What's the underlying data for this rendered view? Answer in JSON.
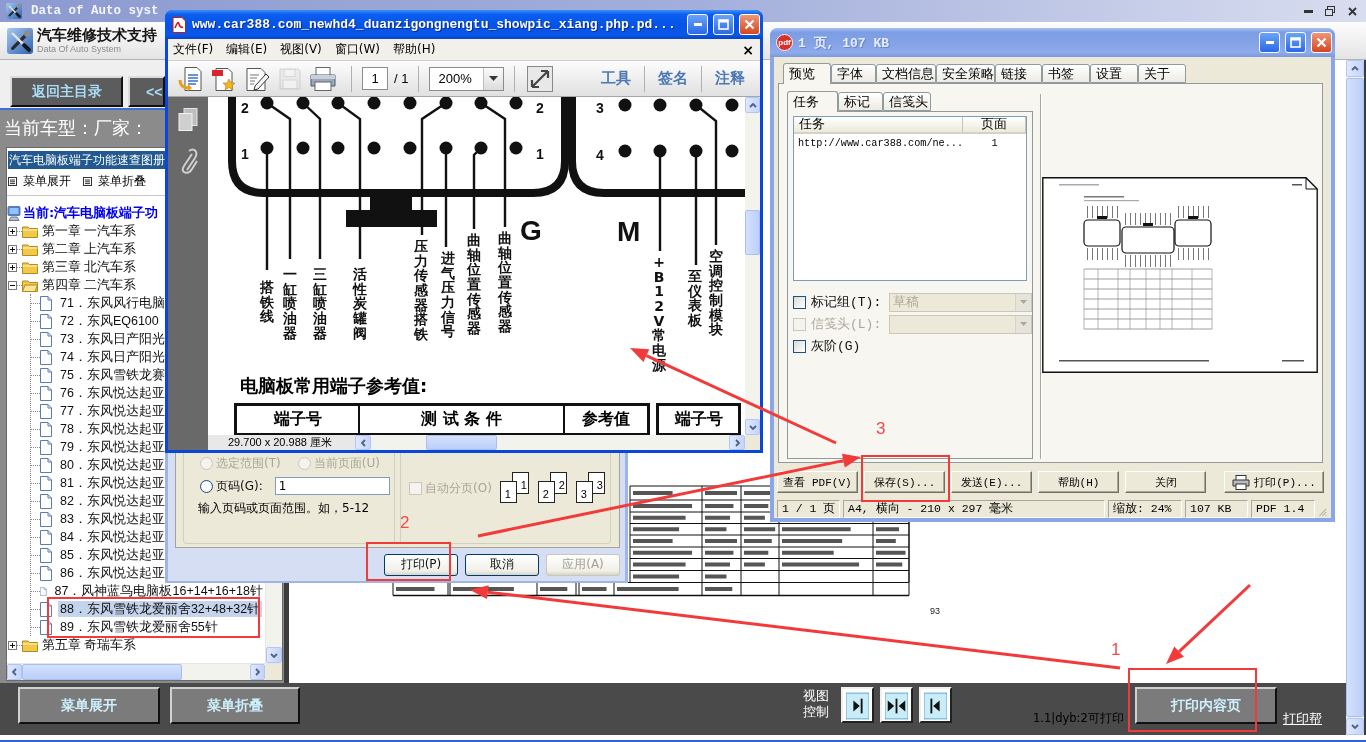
{
  "main_window": {
    "title": "Data of Auto syst",
    "app_name": "汽车维修技术支持",
    "app_subtitle": "Data Of Auto System"
  },
  "nav_buttons": [
    {
      "label": "返回主目录"
    },
    {
      "label": "<<"
    }
  ],
  "current_model": "当前车型：厂家：",
  "catalog_select": {
    "value": "汽车电脑板端子功能速查图册"
  },
  "menu_actions": [
    {
      "label": "菜单展开"
    },
    {
      "label": "菜单折叠"
    }
  ],
  "tree": {
    "current": "当前:汽车电脑板端子功",
    "items": [
      {
        "label": "第一章 一汽车系",
        "expanded": false,
        "selected": false
      },
      {
        "label": "第二章 上汽车系",
        "expanded": false,
        "selected": false
      },
      {
        "label": "第三章 北汽车系",
        "expanded": false,
        "selected": false
      },
      {
        "label": "第四章 二汽车系",
        "expanded": true,
        "selected": false,
        "children": [
          {
            "label": "71．东风风行电脑",
            "selected": false
          },
          {
            "label": "72．东风EQ6100",
            "selected": false
          },
          {
            "label": "73．东风日产阳光",
            "selected": false
          },
          {
            "label": "74．东风日产阳光",
            "selected": false
          },
          {
            "label": "75．东风雪铁龙赛",
            "selected": false
          },
          {
            "label": "76．东风悦达起亚",
            "selected": false
          },
          {
            "label": "77．东风悦达起亚",
            "selected": false
          },
          {
            "label": "78．东风悦达起亚",
            "selected": false
          },
          {
            "label": "79．东风悦达起亚",
            "selected": false
          },
          {
            "label": "80．东风悦达起亚",
            "selected": false
          },
          {
            "label": "81．东风悦达起亚",
            "selected": false
          },
          {
            "label": "82．东风悦达起亚",
            "selected": false
          },
          {
            "label": "83．东风悦达起亚",
            "selected": false
          },
          {
            "label": "84．东风悦达起亚",
            "selected": false
          },
          {
            "label": "85．东风悦达起亚",
            "selected": false
          },
          {
            "label": "86．东风悦达起亚",
            "selected": false
          },
          {
            "label": "87．风神蓝鸟电脑板16+14+16+18针",
            "selected": false
          },
          {
            "label": "88．东风雪铁龙爱丽舍32+48+32针",
            "selected": true
          },
          {
            "label": "89．东风雪铁龙爱丽舍55针",
            "selected": false
          }
        ]
      },
      {
        "label": "第五章 奇瑞车系",
        "expanded": false,
        "selected": false
      }
    ]
  },
  "document_page": {
    "page_number": "93"
  },
  "bottom_bar": {
    "buttons": [
      {
        "label": "菜单展开"
      },
      {
        "label": "菜单折叠"
      }
    ],
    "view_label": "视图控制",
    "print_info": "1.1|dyb:2可打印",
    "print_button": "打印内容页",
    "help_link": "打印帮"
  },
  "pdf_viewer": {
    "title": "www.car388.com_newhd4_duanzigongnengtu_showpic_xiang.php.pd...",
    "menu": [
      {
        "label": "文件(F)"
      },
      {
        "label": "编辑(E)"
      },
      {
        "label": "视图(V)"
      },
      {
        "label": "窗口(W)"
      },
      {
        "label": "帮助(H)"
      }
    ],
    "close_mark": "×",
    "toolbar_buttons": [
      {
        "disabled": false
      },
      {
        "disabled": false
      },
      {
        "disabled": false
      },
      {
        "disabled": true
      },
      {
        "disabled": false
      }
    ],
    "page": "1",
    "page_count": "/ 1",
    "zoom": "200%",
    "tool_tabs": [
      {
        "label": "工具"
      },
      {
        "label": "签名"
      },
      {
        "label": "注释"
      }
    ],
    "document": {
      "row_numbers": [
        "2",
        "1",
        "2",
        "1",
        "3",
        "4"
      ],
      "connector_letters": [
        "G",
        "M"
      ],
      "wire_labels": [
        "搭铁线",
        "一缸喷油器",
        "三缸喷油器",
        "活性炭罐阀",
        "压力传感器搭铁",
        "进气压力信号",
        "曲轴位置传感器",
        "曲轴位置传感器",
        "+B12V常电源",
        "至仪表板",
        "空调控制模块"
      ],
      "heading": "电脑板常用端子参考值:",
      "table_headers": [
        "端子号",
        "测 试 条 件",
        "参考值",
        "端子号"
      ]
    },
    "page_size": "29.700 x 20.988 厘米"
  },
  "print_dialog": {
    "range_options": [
      {
        "label": "选定范围(T)",
        "selected": false,
        "disabled": true
      },
      {
        "label": "当前页面(U)",
        "selected": false,
        "disabled": true
      },
      {
        "label": "页码(G):",
        "selected": false,
        "disabled": false
      }
    ],
    "pages_value": "1",
    "pages_hint": "输入页码或页面范围。如，5-12",
    "collate": {
      "label": "自动分页(O)",
      "checked": false,
      "disabled": true
    },
    "collate_pages": [
      {
        "front": "1",
        "back": "1"
      },
      {
        "front": "2",
        "back": "2"
      },
      {
        "front": "3",
        "back": "3"
      }
    ],
    "buttons": [
      {
        "label": "打印(P)",
        "disabled": false
      },
      {
        "label": "取消",
        "disabled": false
      },
      {
        "label": "应用(A)",
        "disabled": true
      }
    ]
  },
  "pdf_printer": {
    "icon_label": "pdf",
    "title": "1 页, 107 KB",
    "tabs": [
      {
        "label": "预览",
        "selected": true
      },
      {
        "label": "字体",
        "selected": false
      },
      {
        "label": "文档信息",
        "selected": false
      },
      {
        "label": "安全策略",
        "selected": false
      },
      {
        "label": "链接",
        "selected": false
      },
      {
        "label": "书签",
        "selected": false
      },
      {
        "label": "设置",
        "selected": false
      },
      {
        "label": "关于",
        "selected": false
      }
    ],
    "subtabs": [
      {
        "label": "任务",
        "selected": true
      },
      {
        "label": "标记",
        "selected": false
      },
      {
        "label": "信笺头",
        "selected": false
      }
    ],
    "job_columns": [
      "任务",
      "页面"
    ],
    "jobs": [
      {
        "task": "http://www.car388.com/ne...",
        "pages": "1"
      }
    ],
    "options": [
      {
        "kind": "select",
        "label": "标记组(T):",
        "checked": false,
        "label_disabled": false,
        "select_disabled": true,
        "value": "草稿"
      },
      {
        "kind": "select",
        "label": "信笺头(L):",
        "checked": false,
        "label_disabled": true,
        "select_disabled": true
      },
      {
        "kind": "check",
        "label": "灰阶(G)",
        "checked": false,
        "label_disabled": false
      }
    ],
    "buttons": [
      {
        "kind": "plain",
        "label": "查看 PDF(V)"
      },
      {
        "kind": "plain",
        "label": "保存(S)..."
      },
      {
        "kind": "plain",
        "label": "发送(E)..."
      },
      {
        "kind": "plain",
        "label": "帮助(H)"
      },
      {
        "kind": "plain",
        "label": "关闭"
      },
      {
        "kind": "print",
        "label": "打印(P)..."
      }
    ],
    "status": [
      "1 / 1 页",
      "A4, 横向 - 210 x 297 毫米",
      "缩放: 24%",
      "107 KB",
      "PDF 1.4"
    ]
  },
  "annotations": [
    {
      "label": "1"
    },
    {
      "label": "2"
    },
    {
      "label": "3"
    }
  ]
}
